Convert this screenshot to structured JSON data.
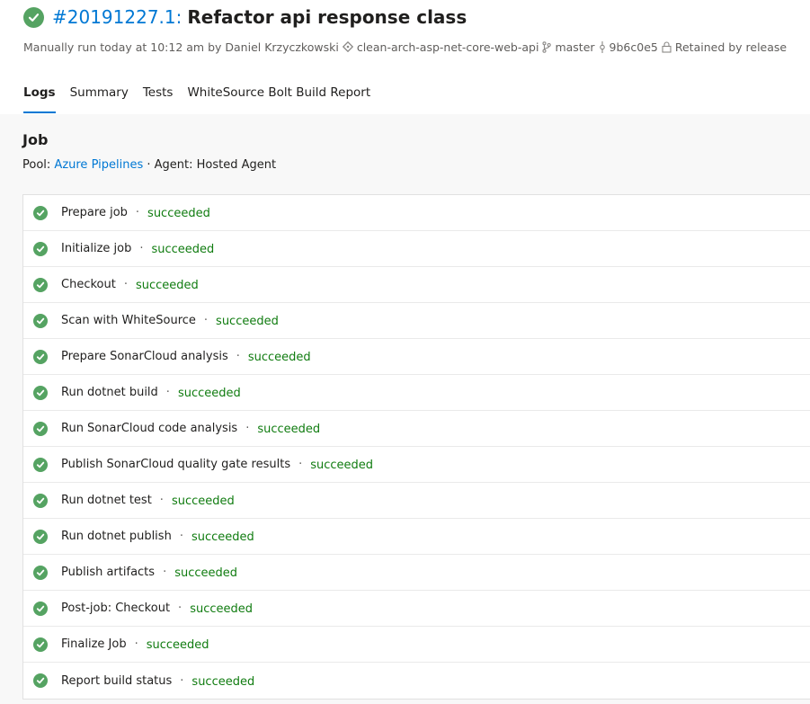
{
  "header": {
    "run_number": "#20191227.1",
    "run_colon": ":",
    "run_title": "Refactor api response class",
    "meta": {
      "trigger": "Manually run today at 10:12 am by Daniel Krzyczkowski",
      "repository": "clean-arch-asp-net-core-web-api",
      "branch": "master",
      "commit": "9b6c0e5",
      "retention": "Retained by release"
    }
  },
  "tabs": [
    {
      "label": "Logs"
    },
    {
      "label": "Summary"
    },
    {
      "label": "Tests"
    },
    {
      "label": "WhiteSource Bolt Build Report"
    }
  ],
  "job": {
    "title": "Job",
    "pool_label": "Pool: ",
    "pool_link": "Azure Pipelines",
    "agent": " · Agent: Hosted Agent"
  },
  "steps": [
    {
      "name": "Prepare job",
      "status": "succeeded"
    },
    {
      "name": "Initialize job",
      "status": "succeeded"
    },
    {
      "name": "Checkout",
      "status": "succeeded"
    },
    {
      "name": "Scan with WhiteSource",
      "status": "succeeded"
    },
    {
      "name": "Prepare SonarCloud analysis",
      "status": "succeeded"
    },
    {
      "name": "Run dotnet build",
      "status": "succeeded"
    },
    {
      "name": "Run SonarCloud code analysis",
      "status": "succeeded"
    },
    {
      "name": "Publish SonarCloud quality gate results",
      "status": "succeeded"
    },
    {
      "name": "Run dotnet test",
      "status": "succeeded"
    },
    {
      "name": "Run dotnet publish",
      "status": "succeeded"
    },
    {
      "name": "Publish artifacts",
      "status": "succeeded"
    },
    {
      "name": "Post-job: Checkout",
      "status": "succeeded"
    },
    {
      "name": "Finalize Job",
      "status": "succeeded"
    },
    {
      "name": "Report build status",
      "status": "succeeded"
    }
  ],
  "step_separator": "·",
  "colors": {
    "success": "#55a362",
    "success_text": "#107c10",
    "accent": "#0078d4"
  },
  "icons": {
    "status": "check-circle-icon",
    "repository": "git-repo-icon",
    "branch": "branch-icon",
    "commit": "commit-icon",
    "retention": "lock-icon"
  }
}
